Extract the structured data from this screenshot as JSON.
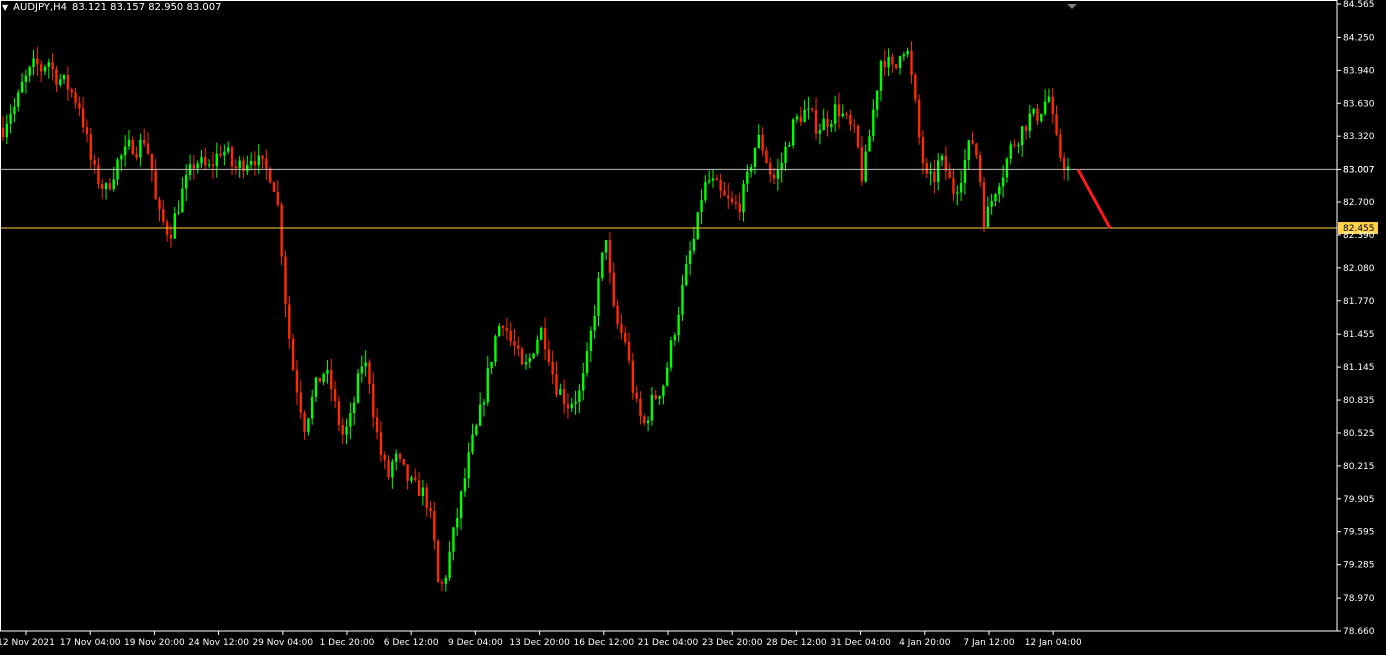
{
  "window": {
    "symbol_label": "AUDJPY,H4",
    "ohlc_text": "83.121 83.157 82.950 83.007"
  },
  "colors": {
    "background": "#000000",
    "bull": "#00ff00",
    "bear": "#ff2a00",
    "axis": "#ffffff",
    "bid_line": "#c0c0c0",
    "level_line": "#ffd24a",
    "forecast": "#ff1a1a"
  },
  "chart_data": {
    "type": "candlestick",
    "title": "AUDJPY,H4",
    "ylim": [
      78.66,
      84.565
    ],
    "y_ticks": [
      "84.565",
      "84.250",
      "83.940",
      "83.630",
      "83.320",
      "83.007",
      "82.700",
      "82.390",
      "82.080",
      "81.770",
      "81.455",
      "81.145",
      "80.835",
      "80.525",
      "80.215",
      "79.905",
      "79.595",
      "79.285",
      "78.970",
      "78.660"
    ],
    "x_ticks": [
      "12 Nov 2021",
      "17 Nov 04:00",
      "19 Nov 20:00",
      "24 Nov 12:00",
      "29 Nov 04:00",
      "1 Dec 20:00",
      "6 Dec 12:00",
      "9 Dec 04:00",
      "13 Dec 20:00",
      "16 Dec 12:00",
      "21 Dec 04:00",
      "23 Dec 20:00",
      "28 Dec 12:00",
      "31 Dec 04:00",
      "4 Jan 20:00",
      "7 Jan 12:00",
      "12 Jan 04:00"
    ],
    "bid_price": 83.007,
    "bid_label": "83.007",
    "level_price": 82.455,
    "level_label": "82.455",
    "close_path": [
      83.4,
      83.55,
      83.6,
      83.8,
      83.9,
      84.0,
      83.95,
      84.05,
      83.9,
      83.85,
      83.8,
      83.7,
      83.6,
      83.3,
      83.0,
      82.9,
      82.8,
      82.95,
      83.1,
      83.15,
      83.25,
      83.2,
      83.3,
      83.1,
      82.6,
      82.5,
      82.4,
      82.6,
      82.8,
      82.95,
      83.1,
      83.05,
      83.0,
      83.1,
      83.2,
      83.15,
      83.0,
      83.05,
      83.1,
      83.15,
      83.05,
      83.0,
      82.95,
      82.6,
      81.8,
      81.2,
      80.9,
      80.6,
      80.8,
      81.0,
      81.1,
      81.0,
      80.7,
      80.5,
      80.6,
      80.9,
      81.2,
      81.1,
      80.6,
      80.3,
      80.1,
      80.3,
      80.2,
      80.1,
      80.0,
      80.0,
      79.9,
      79.6,
      79.0,
      79.2,
      79.5,
      79.8,
      80.1,
      80.4,
      80.6,
      80.9,
      81.2,
      81.5,
      81.6,
      81.4,
      81.3,
      81.1,
      81.2,
      81.4,
      81.5,
      81.3,
      81.0,
      80.9,
      80.8,
      80.85,
      80.9,
      81.2,
      81.6,
      82.0,
      82.4,
      81.7,
      81.5,
      81.4,
      81.0,
      80.7,
      80.6,
      80.8,
      80.9,
      81.0,
      81.3,
      81.6,
      81.9,
      82.2,
      82.4,
      82.8,
      82.9,
      82.85,
      82.75,
      82.7,
      82.65,
      82.7,
      82.9,
      83.2,
      83.3,
      83.1,
      82.9,
      83.0,
      83.2,
      83.4,
      83.5,
      83.55,
      83.5,
      83.4,
      83.45,
      83.5,
      83.6,
      83.5,
      83.4,
      83.3,
      82.9,
      83.3,
      83.7,
      84.1,
      84.0,
      83.9,
      84.2,
      84.1,
      83.7,
      83.2,
      82.9,
      82.9,
      83.1,
      83.0,
      82.8,
      82.9,
      83.1,
      83.3,
      83.1,
      82.5,
      82.7,
      82.9,
      83.0,
      83.2,
      83.3,
      83.4,
      83.5,
      83.5,
      83.6,
      83.7,
      83.3,
      83.1,
      83.007
    ],
    "forecast": {
      "from": 83.007,
      "to": 82.455
    }
  }
}
